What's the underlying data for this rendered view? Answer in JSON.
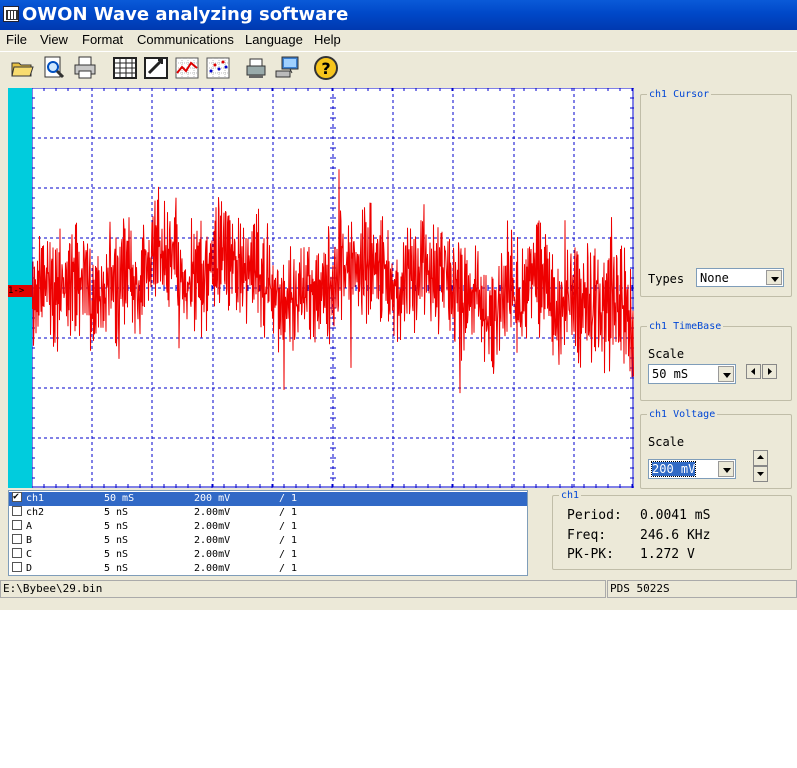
{
  "window": {
    "title": "OWON Wave analyzing software"
  },
  "menu": [
    "File",
    "View",
    "Format",
    "Communications",
    "Language",
    "Help"
  ],
  "toolbar": [
    {
      "name": "open-folder-icon"
    },
    {
      "name": "zoom-preview-icon"
    },
    {
      "name": "print-icon"
    },
    {
      "name": "table-icon"
    },
    {
      "name": "edit-chart-icon"
    },
    {
      "name": "line-chart-icon"
    },
    {
      "name": "scatter-chart-icon"
    },
    {
      "name": "printer-setup-icon"
    },
    {
      "name": "computer-connect-icon"
    },
    {
      "name": "help-icon"
    }
  ],
  "scope": {
    "channel_marker": "1->",
    "trace_color": "#ee0000",
    "grid_color": "#0000cc",
    "marker_bar_color": "#00ccdd"
  },
  "cursor_panel": {
    "legend": "ch1 Cursor",
    "types_label": "Types",
    "types_value": "None"
  },
  "timebase_panel": {
    "legend": "ch1 TimeBase",
    "scale_label": "Scale",
    "scale_value": "50 mS"
  },
  "voltage_panel": {
    "legend": "ch1 Voltage",
    "scale_label": "Scale",
    "scale_value": "200 mV"
  },
  "channels": [
    {
      "name": "ch1",
      "timebase": "50 mS",
      "volt": "200 mV",
      "probe": "/ 1",
      "checked": true,
      "selected": true
    },
    {
      "name": "ch2",
      "timebase": "5 nS",
      "volt": "2.00mV",
      "probe": "/ 1",
      "checked": false,
      "selected": false
    },
    {
      "name": "A",
      "timebase": "5 nS",
      "volt": "2.00mV",
      "probe": "/ 1",
      "checked": false,
      "selected": false
    },
    {
      "name": "B",
      "timebase": "5 nS",
      "volt": "2.00mV",
      "probe": "/ 1",
      "checked": false,
      "selected": false
    },
    {
      "name": "C",
      "timebase": "5 nS",
      "volt": "2.00mV",
      "probe": "/ 1",
      "checked": false,
      "selected": false
    },
    {
      "name": "D",
      "timebase": "5 nS",
      "volt": "2.00mV",
      "probe": "/ 1",
      "checked": false,
      "selected": false
    }
  ],
  "measure_panel": {
    "legend": "ch1",
    "period_label": "Period:",
    "period_value": "0.0041 mS",
    "freq_label": "Freq:",
    "freq_value": "246.6 KHz",
    "pkpk_label": "PK-PK:",
    "pkpk_value": "1.272 V"
  },
  "status": {
    "file_path": "E:\\Bybee\\29.bin",
    "device": "PDS 5022S"
  }
}
